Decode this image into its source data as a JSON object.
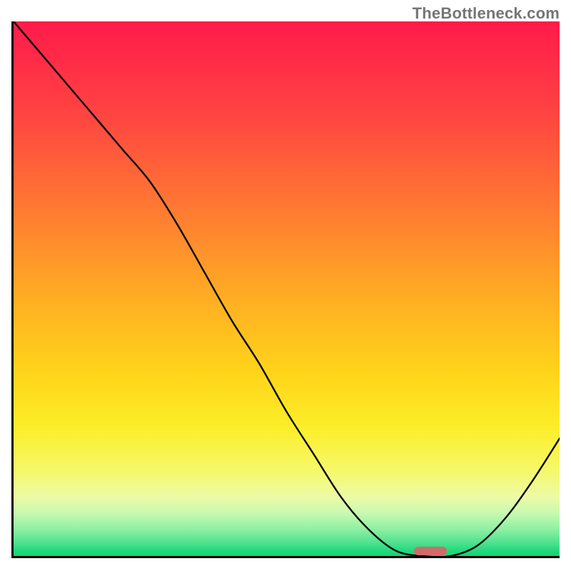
{
  "watermark": "TheBottleneck.com",
  "chart_data": {
    "type": "line",
    "title": "",
    "xlabel": "",
    "ylabel": "",
    "xlim": [
      0,
      100
    ],
    "ylim": [
      0,
      100
    ],
    "grid": false,
    "series": [
      {
        "name": "curve",
        "x": [
          0,
          5,
          10,
          15,
          20,
          25,
          30,
          35,
          40,
          45,
          50,
          55,
          60,
          65,
          70,
          75,
          80,
          85,
          90,
          95,
          100
        ],
        "y": [
          100,
          94,
          88,
          82,
          76,
          70,
          62,
          53,
          44,
          36,
          27,
          19,
          11,
          5,
          1,
          0,
          0,
          2,
          7,
          14,
          22
        ]
      }
    ],
    "marker": {
      "x": 76,
      "width_pct": 6,
      "y": 0.5
    },
    "gradient_stops": [
      {
        "pct": 0,
        "color": "#ff1b4a"
      },
      {
        "pct": 18,
        "color": "#ff4641"
      },
      {
        "pct": 42,
        "color": "#ff8f2c"
      },
      {
        "pct": 66,
        "color": "#ffd51a"
      },
      {
        "pct": 84,
        "color": "#f6f86a"
      },
      {
        "pct": 95,
        "color": "#8ef0a3"
      },
      {
        "pct": 100,
        "color": "#14d476"
      }
    ]
  }
}
